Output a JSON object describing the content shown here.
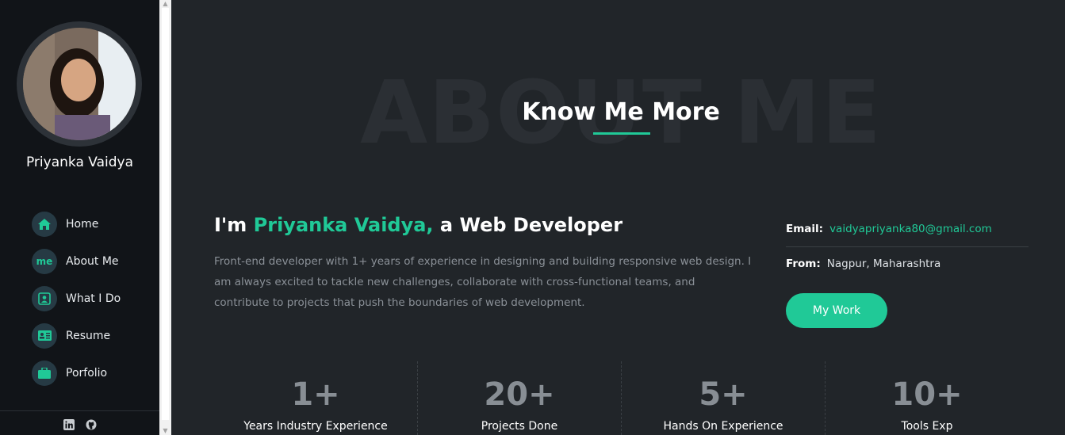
{
  "profile": {
    "name": "Priyanka Vaidya"
  },
  "nav": {
    "items": [
      {
        "label": "Home",
        "icon": "home-icon"
      },
      {
        "label": "About Me",
        "icon": "me-icon",
        "icon_text": "me"
      },
      {
        "label": "What I Do",
        "icon": "monitor-person-icon"
      },
      {
        "label": "Resume",
        "icon": "id-card-icon"
      },
      {
        "label": "Porfolio",
        "icon": "briefcase-icon"
      }
    ]
  },
  "social": {
    "icons": [
      "linkedin-icon",
      "github-icon"
    ]
  },
  "about": {
    "bg_title": "ABOUT ME",
    "title": "Know Me More",
    "intro_prefix": "I'm ",
    "intro_name": "Priyanka Vaidya,",
    "intro_suffix": " a Web Developer",
    "bio": "Front-end developer with 1+ years of experience in designing and building responsive web design. I am always excited to tackle new challenges, collaborate with cross-functional teams, and contribute to projects that push the boundaries of web development."
  },
  "info": {
    "email_label": "Email:",
    "email_value": "vaidyapriyanka80@gmail.com",
    "from_label": "From:",
    "from_value": "Nagpur, Maharashtra",
    "button_label": "My Work"
  },
  "stats": [
    {
      "value": "1+",
      "label": "Years Industry Experience"
    },
    {
      "value": "20+",
      "label": "Projects Done"
    },
    {
      "value": "5+",
      "label": "Hands On Experience"
    },
    {
      "value": "10+",
      "label": "Tools Exp"
    }
  ],
  "colors": {
    "accent": "#20c997",
    "sidebar_bg": "#111418",
    "main_bg": "#212529"
  }
}
